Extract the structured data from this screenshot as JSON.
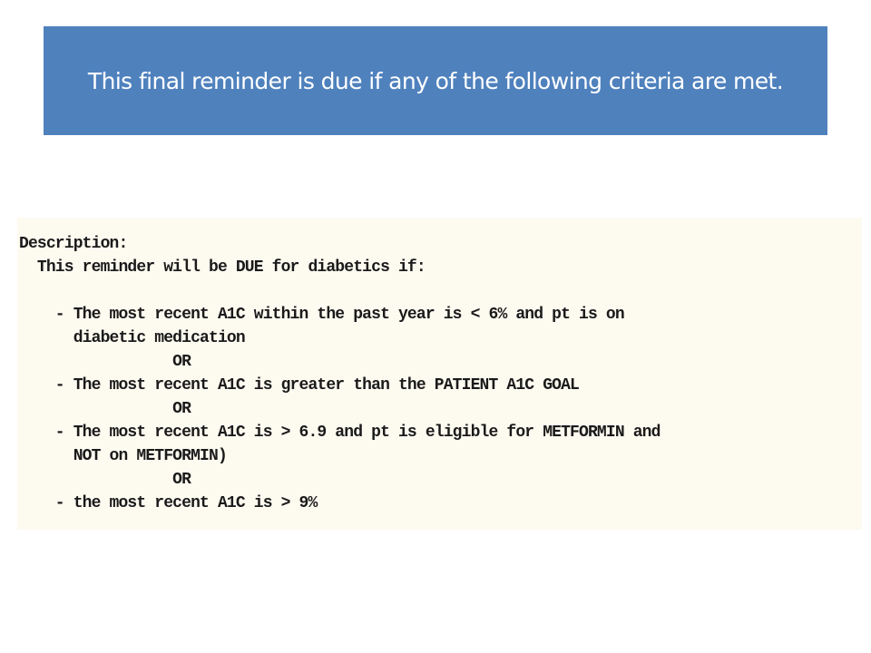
{
  "banner": {
    "text": "This final reminder is due if any of the following criteria are met."
  },
  "description": {
    "lines": [
      "Description:",
      "  This reminder will be DUE for diabetics if:",
      "",
      "    - The most recent A1C within the past year is < 6% and pt is on",
      "      diabetic medication",
      "                 OR",
      "    - The most recent A1C is greater than the PATIENT A1C GOAL",
      "                 OR",
      "    - The most recent A1C is > 6.9 and pt is eligible for METFORMIN and",
      "      NOT on METFORMIN)",
      "                 OR",
      "    - the most recent A1C is > 9%"
    ]
  },
  "colors": {
    "banner_background": "#4f81bd",
    "banner_text": "#ffffff",
    "panel_background": "#fdfaf0"
  }
}
